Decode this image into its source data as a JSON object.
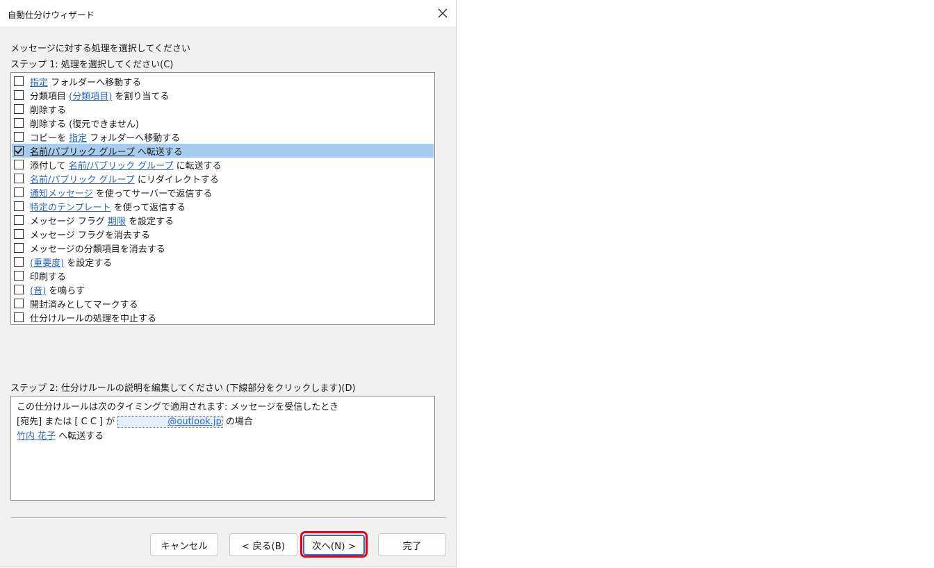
{
  "window": {
    "title": "自動仕分けウィザード"
  },
  "labels": {
    "intro": "メッセージに対する処理を選択してください",
    "step1": "ステップ 1: 処理を選択してください(C)",
    "step2": "ステップ 2: 仕分けルールの説明を編集してください (下線部分をクリックします)(D)"
  },
  "actions": [
    {
      "checked": false,
      "parts": [
        {
          "text": "指定",
          "link": true
        },
        {
          "text": " フォルダーへ移動する",
          "link": false
        }
      ]
    },
    {
      "checked": false,
      "parts": [
        {
          "text": "分類項目 ",
          "link": false
        },
        {
          "text": "(分類項目)",
          "link": true
        },
        {
          "text": " を割り当てる",
          "link": false
        }
      ]
    },
    {
      "checked": false,
      "parts": [
        {
          "text": "削除する",
          "link": false
        }
      ]
    },
    {
      "checked": false,
      "parts": [
        {
          "text": "削除する (復元できません)",
          "link": false
        }
      ]
    },
    {
      "checked": false,
      "parts": [
        {
          "text": "コピーを ",
          "link": false
        },
        {
          "text": "指定",
          "link": true
        },
        {
          "text": " フォルダーへ移動する",
          "link": false
        }
      ]
    },
    {
      "checked": true,
      "parts": [
        {
          "text": "名前/パブリック グループ",
          "link": true
        },
        {
          "text": " へ転送する",
          "link": false
        }
      ]
    },
    {
      "checked": false,
      "parts": [
        {
          "text": "添付して ",
          "link": false
        },
        {
          "text": "名前/パブリック グループ",
          "link": true
        },
        {
          "text": " に転送する",
          "link": false
        }
      ]
    },
    {
      "checked": false,
      "parts": [
        {
          "text": "名前/パブリック グループ",
          "link": true
        },
        {
          "text": " にリダイレクトする",
          "link": false
        }
      ]
    },
    {
      "checked": false,
      "parts": [
        {
          "text": "通知メッセージ",
          "link": true
        },
        {
          "text": " を使ってサーバーで返信する",
          "link": false
        }
      ]
    },
    {
      "checked": false,
      "parts": [
        {
          "text": "特定のテンプレート",
          "link": true
        },
        {
          "text": " を使って返信する",
          "link": false
        }
      ]
    },
    {
      "checked": false,
      "parts": [
        {
          "text": "メッセージ フラグ ",
          "link": false
        },
        {
          "text": "期限",
          "link": true
        },
        {
          "text": " を設定する",
          "link": false
        }
      ]
    },
    {
      "checked": false,
      "parts": [
        {
          "text": "メッセージ フラグを消去する",
          "link": false
        }
      ]
    },
    {
      "checked": false,
      "parts": [
        {
          "text": "メッセージの分類項目を消去する",
          "link": false
        }
      ]
    },
    {
      "checked": false,
      "parts": [
        {
          "text": "(重要度)",
          "link": true
        },
        {
          "text": " を設定する",
          "link": false
        }
      ]
    },
    {
      "checked": false,
      "parts": [
        {
          "text": "印刷する",
          "link": false
        }
      ]
    },
    {
      "checked": false,
      "parts": [
        {
          "text": "(音)",
          "link": true
        },
        {
          "text": " を鳴らす",
          "link": false
        }
      ]
    },
    {
      "checked": false,
      "parts": [
        {
          "text": "開封済みとしてマークする",
          "link": false
        }
      ]
    },
    {
      "checked": false,
      "parts": [
        {
          "text": "仕分けルールの処理を中止する",
          "link": false
        }
      ]
    }
  ],
  "description": {
    "line1": "この仕分けルールは次のタイミングで適用されます: メッセージを受信したとき",
    "line2_prefix": "[宛先] または [ C C ] が ",
    "line2_email": "@outlook.jp",
    "line2_suffix": " の場合",
    "line3_link": "竹内 花子",
    "line3_suffix": " へ転送する"
  },
  "buttons": {
    "cancel": "キャンセル",
    "back": "< 戻る(B)",
    "next": "次へ(N) >",
    "finish": "完了"
  },
  "colors": {
    "selection": "#a6cdef",
    "link": "#2b66c9",
    "highlight_frame": "#e60012",
    "dialog_bg": "#f0f0f0"
  }
}
